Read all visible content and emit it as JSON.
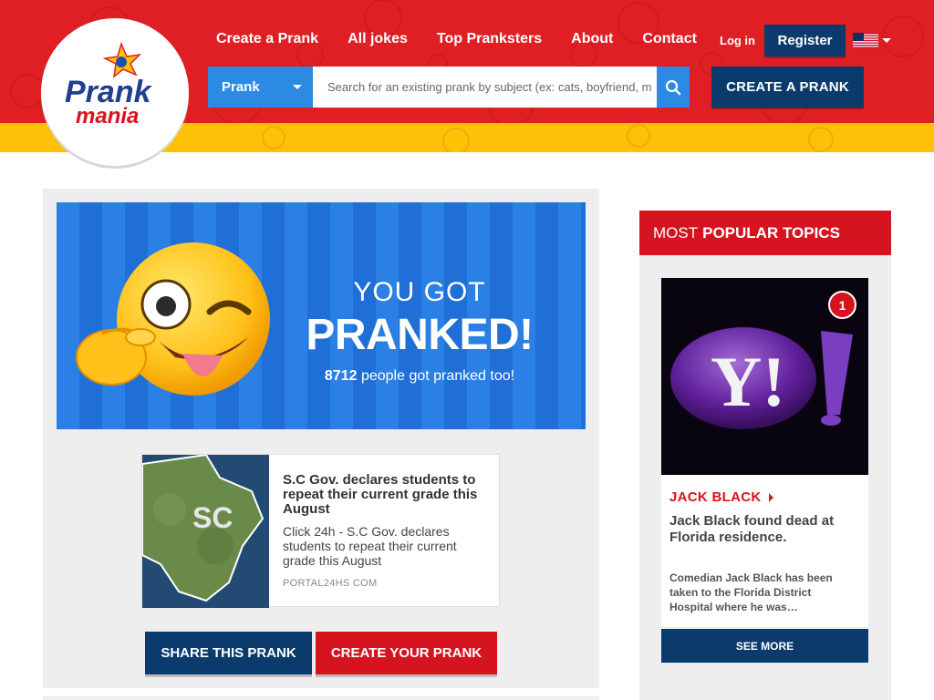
{
  "brand": {
    "logo_text": "Prank mania"
  },
  "nav": {
    "items": [
      "Create a Prank",
      "All jokes",
      "Top Pranksters",
      "About",
      "Contact"
    ],
    "login": "Log in",
    "register": "Register",
    "language_icon": "us-flag-icon"
  },
  "search": {
    "category": "Prank",
    "placeholder": "Search for an existing prank by subject (ex: cats, boyfriend, m",
    "button_icon": "search-icon"
  },
  "header_cta": "CREATE A PRANK",
  "banner": {
    "line1": "YOU GOT",
    "line2": "PRANKED!",
    "count": "8712",
    "count_suffix": " people got pranked too!"
  },
  "news": {
    "image_label": "SC",
    "title": "S.C Gov. declares students to repeat their current grade this August",
    "description": "Click 24h - S.C Gov. declares students to repeat their current grade this August",
    "source": "PORTAL24HS COM"
  },
  "actions": {
    "share": "SHARE THIS PRANK",
    "create": "CREATE YOUR PRANK"
  },
  "sidebar": {
    "header_light": "MOST",
    "header_bold": "POPULAR TOPICS",
    "topic": {
      "rank": "1",
      "category": "JACK BLACK",
      "title": "Jack Black found dead at Florida residence.",
      "description": "Comedian Jack Black has been taken to the Florida District Hospital where he was…",
      "image_text": "Y!"
    },
    "see_more": "SEE MORE"
  },
  "colors": {
    "header_red": "#e01f25",
    "yellow": "#ffc107",
    "navy": "#0b3a6d",
    "blue": "#2d8ae3",
    "accent_red": "#d6141f"
  }
}
